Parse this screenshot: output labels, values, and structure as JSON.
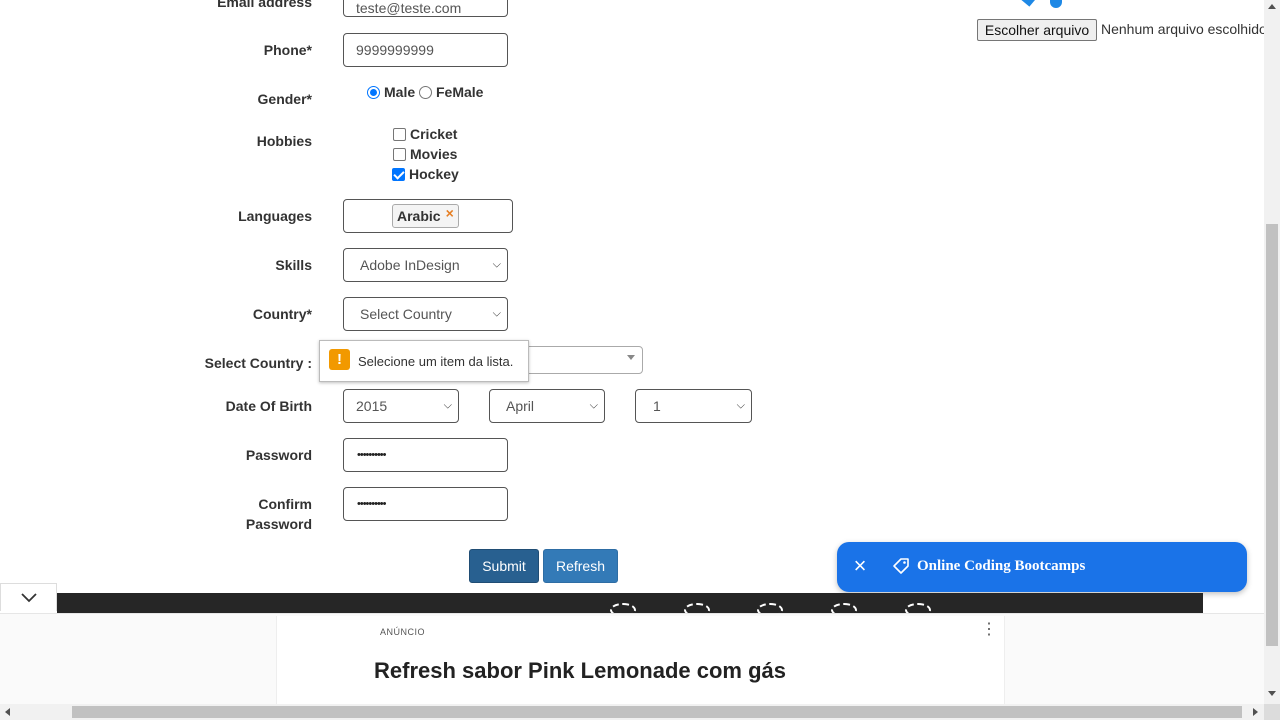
{
  "form": {
    "email": {
      "label": "Email address",
      "value": "teste@teste.com"
    },
    "phone": {
      "label": "Phone*",
      "value": "9999999999"
    },
    "gender": {
      "label": "Gender*",
      "options": [
        "Male",
        "FeMale"
      ],
      "selected": "Male"
    },
    "hobbies": {
      "label": "Hobbies",
      "items": [
        {
          "label": "Cricket",
          "checked": false
        },
        {
          "label": "Movies",
          "checked": false
        },
        {
          "label": "Hockey",
          "checked": true
        }
      ]
    },
    "languages": {
      "label": "Languages",
      "selected_tag": "Arabic",
      "remove_glyph": "×"
    },
    "skills": {
      "label": "Skills",
      "value": "Adobe InDesign"
    },
    "country": {
      "label": "Country*",
      "value": "Select Country"
    },
    "select_country": {
      "label": "Select Country :"
    },
    "validation_tooltip": {
      "icon": "!",
      "text": "Selecione um item da lista."
    },
    "dob": {
      "label": "Date Of Birth",
      "year": "2015",
      "month": "April",
      "day": "1"
    },
    "password": {
      "label": "Password",
      "value": "••••••••••"
    },
    "confirm_password": {
      "label_line1": "Confirm",
      "label_line2": "Password",
      "value": "••••••••••"
    },
    "submit_label": "Submit",
    "refresh_label": "Refresh"
  },
  "file_upload": {
    "button_label": "Escolher arquivo",
    "status": "Nenhum arquivo escolhido"
  },
  "toast": {
    "text": "Online Coding Bootcamps",
    "close_icon": "close-icon",
    "tag_icon": "tag-icon",
    "color": "#1a73e8"
  },
  "ad": {
    "label": "ANÚNCIO",
    "headline": "Refresh sabor Pink Lemonade com gás"
  },
  "colors": {
    "primary_button": "#286090",
    "secondary_button": "#337ab7",
    "warning": "#f29900",
    "accent": "#0075ff"
  }
}
